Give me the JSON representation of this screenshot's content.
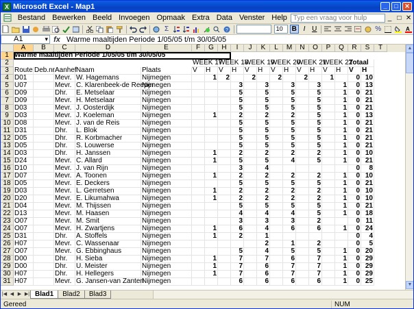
{
  "app": {
    "title": "Microsoft Excel - Map1",
    "logo": "X"
  },
  "window_controls": {
    "minimize": "_",
    "restore": "□",
    "close": "✕"
  },
  "menu": {
    "items": [
      "Bestand",
      "Bewerken",
      "Beeld",
      "Invoegen",
      "Opmaak",
      "Extra",
      "Data",
      "Venster",
      "Help"
    ],
    "help_placeholder": "Typ een vraag voor hulp",
    "doc_controls": [
      "_",
      "□",
      "✕"
    ]
  },
  "toolbar": {
    "font_size": "10",
    "percent": "%",
    "sigma": "Σ"
  },
  "formula_bar": {
    "name_box": "A1",
    "fx": "fx",
    "content": "Warme maaltijden Periode   1/05/05 t/m 30/05/05"
  },
  "columns": [
    "A",
    "B",
    "C",
    "D",
    "E",
    "F",
    "G",
    "H",
    "I",
    "J",
    "K",
    "L",
    "M",
    "N",
    "O",
    "P",
    "Q",
    "R",
    "S",
    "T"
  ],
  "selected_column": "A",
  "selected_row": "1",
  "sheet": {
    "title": "Warme maaltijden Periode   1/05/05 t/m 30/05/05",
    "weeks": [
      "WEEK 17",
      "WEEK 18",
      "WEEK 19",
      "WEEK 20",
      "WEEK 21",
      "WEEK 22"
    ],
    "total_label": "Totaal",
    "vh": [
      "V",
      "H"
    ],
    "headers": [
      "Route",
      "Deb.nr.",
      "Aanhef",
      "Naam",
      "Plaats"
    ],
    "rows": [
      {
        "n": "4",
        "route": "D01",
        "aanhef": "Mevr.",
        "naam": "W. Hagemans",
        "plaats": "Nijmegen",
        "w": [
          "",
          "1",
          "2",
          "",
          "2",
          "",
          "2",
          "",
          "2",
          "",
          "1",
          ""
        ],
        "tv": "0",
        "th": "10"
      },
      {
        "n": "5",
        "route": "U07",
        "aanhef": "Mevr.",
        "naam": "C. Klarenbeek-de Reeper",
        "plaats": "Nijmegen",
        "w": [
          "",
          "",
          "",
          "3",
          "",
          "3",
          "",
          "3",
          "",
          "3",
          "",
          "1"
        ],
        "tv": "0",
        "th": "13"
      },
      {
        "n": "6",
        "route": "D09",
        "aanhef": "Dhr.",
        "naam": "E. Metselaar",
        "plaats": "Nijmegen",
        "w": [
          "",
          "",
          "",
          "5",
          "",
          "5",
          "",
          "5",
          "",
          "5",
          "",
          "1"
        ],
        "tv": "0",
        "th": "21"
      },
      {
        "n": "7",
        "route": "D09",
        "aanhef": "Mevr.",
        "naam": "H. Metselaar",
        "plaats": "Nijmegen",
        "w": [
          "",
          "",
          "",
          "5",
          "",
          "5",
          "",
          "5",
          "",
          "5",
          "",
          "1"
        ],
        "tv": "0",
        "th": "21"
      },
      {
        "n": "8",
        "route": "D03",
        "aanhef": "Mevr.",
        "naam": "J. Oosterdijk",
        "plaats": "Nijmegen",
        "w": [
          "",
          "",
          "",
          "5",
          "",
          "5",
          "",
          "5",
          "",
          "5",
          "",
          "1"
        ],
        "tv": "0",
        "th": "21"
      },
      {
        "n": "9",
        "route": "D03",
        "aanhef": "Mevr.",
        "naam": "J. Koeleman",
        "plaats": "Nijmegen",
        "w": [
          "",
          "1",
          "",
          "2",
          "",
          "2",
          "",
          "2",
          "",
          "5",
          "",
          "1"
        ],
        "tv": "0",
        "th": "13"
      },
      {
        "n": "10",
        "route": "D08",
        "aanhef": "Mevr.",
        "naam": "J.  van de Reis",
        "plaats": "Nijmegen",
        "w": [
          "",
          "",
          "",
          "5",
          "",
          "5",
          "",
          "5",
          "",
          "5",
          "",
          "1"
        ],
        "tv": "0",
        "th": "21"
      },
      {
        "n": "11",
        "route": "D31",
        "aanhef": "Dhr.",
        "naam": "L. Blok",
        "plaats": "Nijmegen",
        "w": [
          "",
          "",
          "",
          "5",
          "",
          "5",
          "",
          "5",
          "",
          "5",
          "",
          "1"
        ],
        "tv": "0",
        "th": "21"
      },
      {
        "n": "12",
        "route": "D05",
        "aanhef": "Dhr.",
        "naam": "R. Korbmacher",
        "plaats": "Nijmegen",
        "w": [
          "",
          "",
          "",
          "5",
          "",
          "5",
          "",
          "5",
          "",
          "5",
          "",
          "1"
        ],
        "tv": "0",
        "th": "21"
      },
      {
        "n": "13",
        "route": "D05",
        "aanhef": "Dhr.",
        "naam": "S. Louwerse",
        "plaats": "Nijmegen",
        "w": [
          "",
          "",
          "",
          "5",
          "",
          "5",
          "",
          "5",
          "",
          "5",
          "",
          "1"
        ],
        "tv": "0",
        "th": "21"
      },
      {
        "n": "14",
        "route": "D03",
        "aanhef": "Dhr.",
        "naam": "H. Janssen",
        "plaats": "Nijmegen",
        "w": [
          "",
          "1",
          "",
          "2",
          "",
          "2",
          "",
          "2",
          "",
          "2",
          "",
          "1"
        ],
        "tv": "0",
        "th": "10"
      },
      {
        "n": "15",
        "route": "D24",
        "aanhef": "Mevr.",
        "naam": "C. Allard",
        "plaats": "Nijmegen",
        "w": [
          "",
          "1",
          "",
          "5",
          "",
          "5",
          "",
          "4",
          "",
          "5",
          "",
          "1"
        ],
        "tv": "0",
        "th": "21"
      },
      {
        "n": "16",
        "route": "D10",
        "aanhef": "Mevr.",
        "naam": "J. van Rijn",
        "plaats": "Nijmegen",
        "w": [
          "",
          "",
          "",
          "3",
          "",
          "4",
          "",
          "",
          "",
          "",
          "",
          ""
        ],
        "tv": "0",
        "th": "8"
      },
      {
        "n": "17",
        "route": "D07",
        "aanhef": "Mevr.",
        "naam": "A. Toonen",
        "plaats": "Nijmegen",
        "w": [
          "",
          "1",
          "",
          "2",
          "",
          "2",
          "",
          "2",
          "",
          "2",
          "",
          "1"
        ],
        "tv": "0",
        "th": "10"
      },
      {
        "n": "18",
        "route": "D05",
        "aanhef": "Mevr.",
        "naam": "E. Deckers",
        "plaats": "Nijmegen",
        "w": [
          "",
          "",
          "",
          "5",
          "",
          "5",
          "",
          "5",
          "",
          "5",
          "",
          "1"
        ],
        "tv": "0",
        "th": "21"
      },
      {
        "n": "19",
        "route": "D03",
        "aanhef": "Mevr.",
        "naam": "L. Gerretsen",
        "plaats": "Nijmegen",
        "w": [
          "",
          "1",
          "",
          "2",
          "",
          "2",
          "",
          "2",
          "",
          "2",
          "",
          "1"
        ],
        "tv": "0",
        "th": "10"
      },
      {
        "n": "20",
        "route": "D20",
        "aanhef": "Mevr.",
        "naam": "E. Likumahwa",
        "plaats": "Nijmegen",
        "w": [
          "",
          "1",
          "",
          "2",
          "",
          "2",
          "",
          "2",
          "",
          "2",
          "",
          "1"
        ],
        "tv": "0",
        "th": "10"
      },
      {
        "n": "21",
        "route": "D04",
        "aanhef": "Mevr.",
        "naam": "M. Thijssen",
        "plaats": "Nijmegen",
        "w": [
          "",
          "",
          "",
          "5",
          "",
          "5",
          "",
          "5",
          "",
          "5",
          "",
          "1"
        ],
        "tv": "0",
        "th": "21"
      },
      {
        "n": "22",
        "route": "D13",
        "aanhef": "Mevr.",
        "naam": "M. Haasen",
        "plaats": "Nijmegen",
        "w": [
          "",
          "",
          "",
          "4",
          "",
          "4",
          "",
          "4",
          "",
          "5",
          "",
          "1"
        ],
        "tv": "0",
        "th": "18"
      },
      {
        "n": "23",
        "route": "O07",
        "aanhef": "Mevr.",
        "naam": "M. Smit",
        "plaats": "Nijmegen",
        "w": [
          "",
          "",
          "",
          "3",
          "",
          "3",
          "",
          "3",
          "",
          "2",
          "",
          ""
        ],
        "tv": "0",
        "th": "11"
      },
      {
        "n": "24",
        "route": "O07",
        "aanhef": "Mevr.",
        "naam": "H. Zwartjens",
        "plaats": "Nijmegen",
        "w": [
          "",
          "1",
          "",
          "6",
          "",
          "4",
          "",
          "6",
          "",
          "6",
          "",
          "1"
        ],
        "tv": "0",
        "th": "24"
      },
      {
        "n": "25",
        "route": "D31",
        "aanhef": "Dhr.",
        "naam": "A. Stoffels",
        "plaats": "Nijmegen",
        "w": [
          "",
          "1",
          "",
          "2",
          "",
          "1",
          "",
          "",
          "",
          "",
          "",
          ""
        ],
        "tv": "0",
        "th": "4"
      },
      {
        "n": "26",
        "route": "H07",
        "aanhef": "Mevr.",
        "naam": "C. Wassenaar",
        "plaats": "Nijmegen",
        "w": [
          "",
          "",
          "",
          "",
          "",
          "2",
          "",
          "1",
          "",
          "2",
          "",
          ""
        ],
        "tv": "0",
        "th": "5"
      },
      {
        "n": "27",
        "route": "O07",
        "aanhef": "Mevr.",
        "naam": "G. Ebbinghaus",
        "plaats": "Nijmegen",
        "w": [
          "",
          "",
          "",
          "5",
          "",
          "4",
          "",
          "5",
          "",
          "5",
          "",
          "1"
        ],
        "tv": "0",
        "th": "20"
      },
      {
        "n": "28",
        "route": "D00",
        "aanhef": "Dhr.",
        "naam": "H. Sieba",
        "plaats": "Nijmegen",
        "w": [
          "",
          "1",
          "",
          "7",
          "",
          "7",
          "",
          "6",
          "",
          "7",
          "",
          "1"
        ],
        "tv": "0",
        "th": "29"
      },
      {
        "n": "29",
        "route": "D00",
        "aanhef": "Dhr.",
        "naam": "U. Meister",
        "plaats": "Nijmegen",
        "w": [
          "",
          "1",
          "",
          "7",
          "",
          "6",
          "",
          "7",
          "",
          "7",
          "",
          "1"
        ],
        "tv": "0",
        "th": "29"
      },
      {
        "n": "30",
        "route": "H07",
        "aanhef": "Dhr.",
        "naam": "H. Hellegers",
        "plaats": "Nijmegen",
        "w": [
          "",
          "1",
          "",
          "7",
          "",
          "6",
          "",
          "7",
          "",
          "7",
          "",
          "1"
        ],
        "tv": "0",
        "th": "29"
      },
      {
        "n": "31",
        "route": "H07",
        "aanhef": "Mevr.",
        "naam": "G. Jansen-van Zanten",
        "plaats": "Nijmegen",
        "w": [
          "",
          "",
          "",
          "6",
          "",
          "6",
          "",
          "6",
          "",
          "6",
          "",
          "1"
        ],
        "tv": "0",
        "th": "25"
      }
    ]
  },
  "tabs": [
    "Blad1",
    "Blad2",
    "Blad3"
  ],
  "active_tab": "Blad1",
  "status": {
    "left": "Gereed",
    "right": "NUM"
  }
}
